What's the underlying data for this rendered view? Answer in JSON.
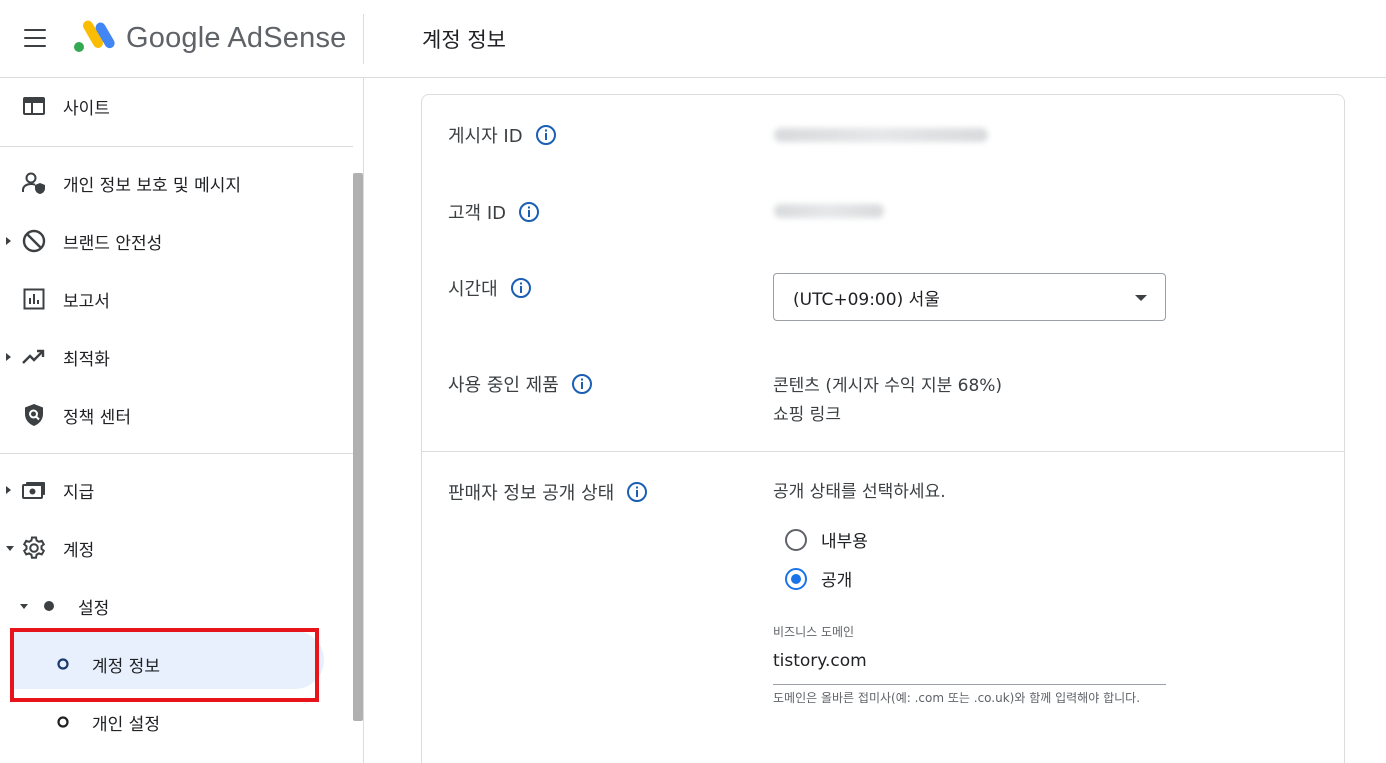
{
  "header": {
    "brand_google": "Google",
    "brand_product": "AdSense",
    "page_title": "계정 정보"
  },
  "sidebar": {
    "items": [
      {
        "label": "사이트",
        "icon": "web-icon"
      },
      {
        "label": "개인 정보 보호 및 메시지",
        "icon": "privacy-person-icon"
      },
      {
        "label": "브랜드 안전성",
        "icon": "block-icon"
      },
      {
        "label": "보고서",
        "icon": "bar-chart-icon"
      },
      {
        "label": "최적화",
        "icon": "trending-up-icon"
      },
      {
        "label": "정책 센터",
        "icon": "policy-shield-icon"
      },
      {
        "label": "지급",
        "icon": "payments-icon"
      },
      {
        "label": "계정",
        "icon": "gear-icon"
      },
      {
        "label": "설정",
        "icon": "bullet-icon"
      },
      {
        "label": "계정 정보",
        "icon": "circle-outline-icon"
      },
      {
        "label": "개인 설정",
        "icon": "circle-outline-icon"
      }
    ],
    "selected": "계정 정보"
  },
  "account": {
    "publisher_id_label": "게시자 ID",
    "customer_id_label": "고객 ID",
    "timezone_label": "시간대",
    "timezone_value": "(UTC+09:00) 서울",
    "products_label": "사용 중인 제품",
    "products": [
      "콘텐츠 (게시자 수익 지분 68%)",
      "쇼핑 링크"
    ],
    "seller_label": "판매자 정보 공개 상태",
    "seller_prompt": "공개 상태를 선택하세요.",
    "radio_options": [
      {
        "label": "내부용",
        "checked": false
      },
      {
        "label": "공개",
        "checked": true
      }
    ],
    "domain_field_label": "비즈니스 도메인",
    "domain_value": "tistory.com",
    "domain_helper": "도메인은 올바른 접미사(예: .com 또는 .co.uk)와 함께 입력해야 합니다."
  },
  "colors": {
    "accent": "#1a73e8",
    "highlight_box": "#e8141b",
    "selected_bg": "#e8f0fe"
  }
}
